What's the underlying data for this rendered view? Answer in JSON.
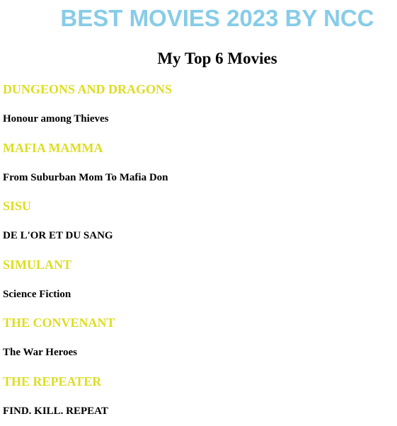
{
  "header": {
    "title": "BEST MOVIES 2023 BY NCC",
    "subtitle": "My Top 6 Movies"
  },
  "colors": {
    "title": "#87cce8",
    "movie_title": "#dddd22",
    "text": "#000000",
    "background": "#ffffff"
  },
  "movies": [
    {
      "title": "DUNGEONS AND DRAGONS",
      "tagline": "Honour among Thieves"
    },
    {
      "title": "MAFIA MAMMA",
      "tagline": "From Suburban Mom To Mafia Don"
    },
    {
      "title": "SISU",
      "tagline": "DE L'OR ET DU SANG"
    },
    {
      "title": "SIMULANT",
      "tagline": "Science Fiction"
    },
    {
      "title": "THE CONVENANT",
      "tagline": "The War Heroes"
    },
    {
      "title": "THE REPEATER",
      "tagline": "FIND. KILL. REPEAT"
    }
  ]
}
